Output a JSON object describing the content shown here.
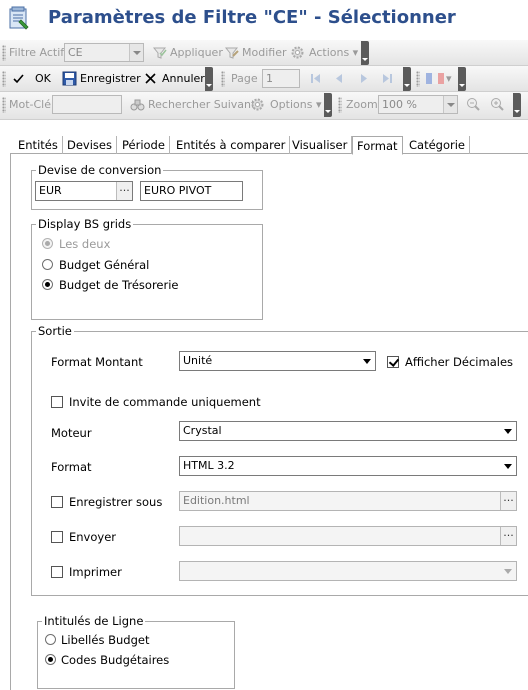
{
  "window": {
    "title": "Paramètres de Filtre \"CE\" - Sélectionner",
    "title_color": "#2d4f8c"
  },
  "toolbar1": {
    "filter_label": "Filtre Actif",
    "filter_value": "CE",
    "apply": "Appliquer",
    "modify": "Modifier",
    "actions": "Actions"
  },
  "toolbar2": {
    "ok": "OK",
    "save": "Enregistrer",
    "cancel": "Annuler",
    "page_label": "Page",
    "page_value": "1"
  },
  "toolbar3": {
    "keyword_label": "Mot-Clé",
    "keyword_value": "",
    "search_next": "Rechercher Suivant",
    "options": "Options",
    "zoom_label": "Zoom",
    "zoom_value": "100 %"
  },
  "tabs": [
    {
      "label": "Entités"
    },
    {
      "label": "Devises"
    },
    {
      "label": "Période"
    },
    {
      "label": "Entités à comparer"
    },
    {
      "label": "Visualiser"
    },
    {
      "label": "Format",
      "active": true
    },
    {
      "label": "Catégorie"
    }
  ],
  "conversion": {
    "legend": "Devise de conversion",
    "currency_code": "EUR",
    "dots": "...",
    "currency_name": "EURO PIVOT"
  },
  "bs_grids": {
    "legend": "Display BS grids",
    "options": [
      {
        "label": "Les deux",
        "selected": true,
        "disabled": true
      },
      {
        "label": "Budget Général",
        "selected": false,
        "disabled": false
      },
      {
        "label": "Budget de Trésorerie",
        "selected": true,
        "disabled": false
      }
    ]
  },
  "sortie": {
    "legend": "Sortie",
    "format_montant_label": "Format Montant",
    "format_montant_value": "Unité",
    "afficher_decimales_label": "Afficher Décimales",
    "afficher_decimales_checked": true,
    "invite_label": "Invite de commande uniquement",
    "invite_checked": false,
    "moteur_label": "Moteur",
    "moteur_value": "Crystal",
    "format_label": "Format",
    "format_value": "HTML 3.2",
    "enregistrer_label": "Enregistrer sous",
    "enregistrer_value": "Edition.html",
    "envoyer_label": "Envoyer",
    "envoyer_value": "",
    "imprimer_label": "Imprimer",
    "imprimer_value": "",
    "dots": "..."
  },
  "intitules": {
    "legend": "Intitulés de Ligne",
    "options": [
      {
        "label": "Libellés Budget",
        "selected": false
      },
      {
        "label": "Codes Budgétaires",
        "selected": true
      }
    ]
  }
}
